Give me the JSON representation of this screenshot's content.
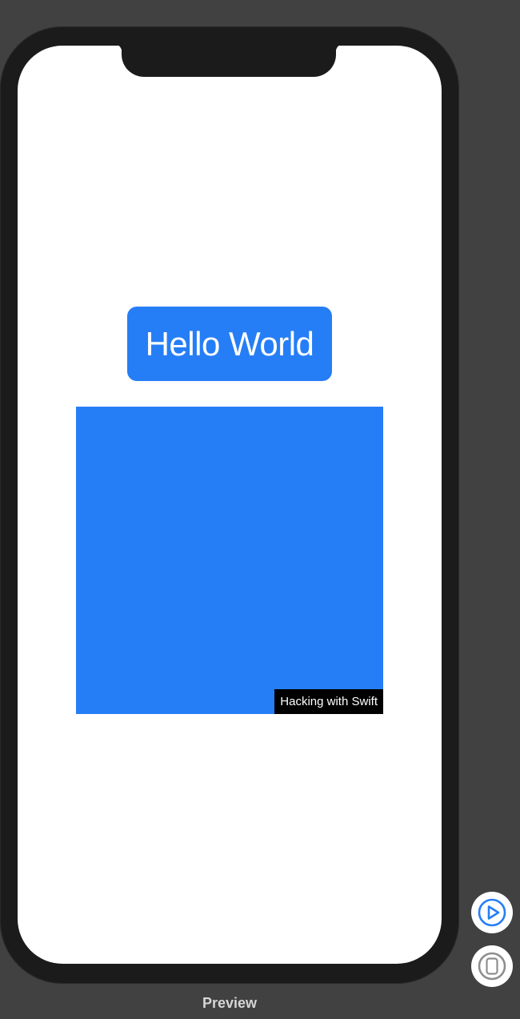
{
  "canvas": {
    "hello_button_label": "Hello World",
    "watermark_text": "Hacking with Swift"
  },
  "preview_panel": {
    "label": "Preview",
    "live_preview_icon": "play-circle-icon",
    "device_icon": "phone-device-icon"
  },
  "colors": {
    "accent_blue": "#267EF6",
    "background": "#414141",
    "device_frame": "#1B1B1B",
    "screen": "#FFFFFF"
  }
}
